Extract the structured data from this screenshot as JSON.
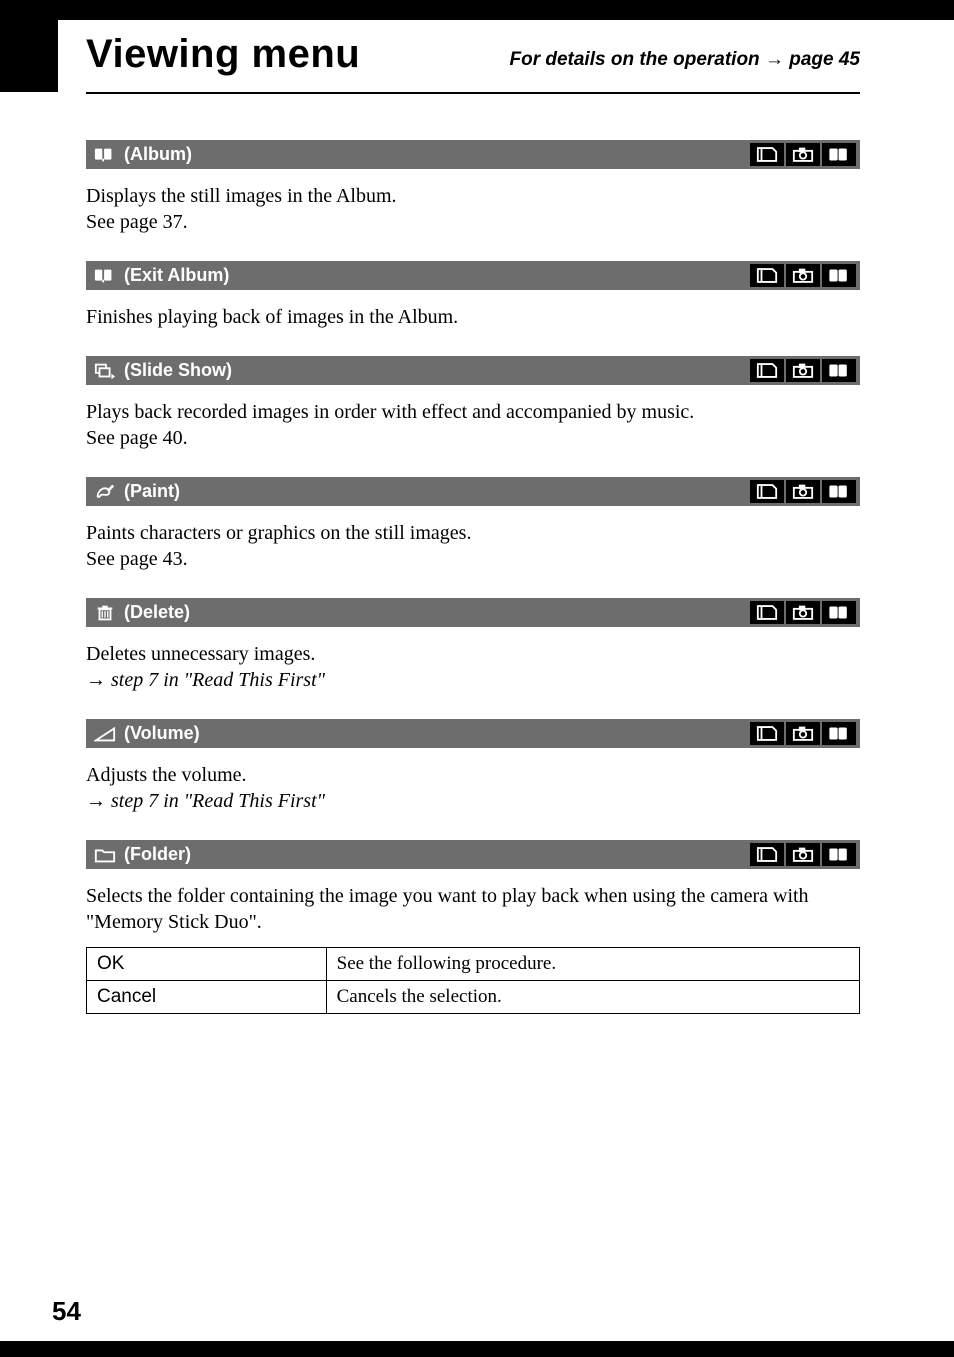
{
  "header": {
    "title": "Viewing menu",
    "subtitle_prefix": "For details on the operation ",
    "subtitle_arrow": "→",
    "subtitle_suffix": " page 45"
  },
  "sections": [
    {
      "icon": "album-icon",
      "label": "(Album)",
      "body_lines": [
        "Displays the still images in the Album.",
        "See page 37."
      ]
    },
    {
      "icon": "album-icon",
      "label": "(Exit Album)",
      "body_lines": [
        "Finishes playing back of images in the Album."
      ]
    },
    {
      "icon": "slideshow-icon",
      "label": "(Slide Show)",
      "body_lines": [
        "Plays back recorded images in order with effect and accompanied by music.",
        "See page 40."
      ]
    },
    {
      "icon": "paint-icon",
      "label": "(Paint)",
      "body_lines": [
        "Paints characters or graphics on the still images.",
        "See page 43."
      ]
    },
    {
      "icon": "delete-icon",
      "label": "(Delete)",
      "body_lines": [
        "Deletes unnecessary images."
      ],
      "xref": "step 7 in \"Read This First\""
    },
    {
      "icon": "volume-icon",
      "label": "(Volume)",
      "body_lines": [
        "Adjusts the volume."
      ],
      "xref": "step 7 in \"Read This First\""
    },
    {
      "icon": "folder-icon",
      "label": "(Folder)",
      "body_lines": [
        "Selects the folder containing the image you want to play back when using the camera with \"Memory Stick Duo\"."
      ],
      "table": [
        {
          "left": "OK",
          "right": "See the following procedure."
        },
        {
          "left": "Cancel",
          "right": "Cancels the selection."
        }
      ]
    }
  ],
  "page_number": "54",
  "arrow": "→"
}
